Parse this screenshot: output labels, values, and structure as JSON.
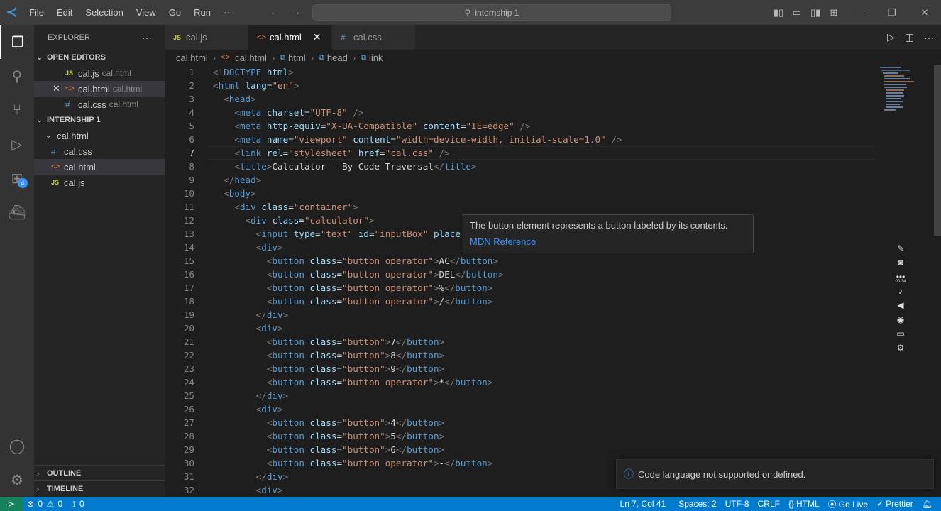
{
  "menu": [
    "File",
    "Edit",
    "Selection",
    "View",
    "Go",
    "Run",
    "···"
  ],
  "search_text": "internship 1",
  "sidebar": {
    "title": "EXPLORER",
    "open_editors_label": "OPEN EDITORS",
    "open_editors": [
      {
        "name": "cal.js",
        "desc": "cal.html",
        "type": "js"
      },
      {
        "name": "cal.html",
        "desc": "cal.html",
        "type": "html"
      },
      {
        "name": "cal.css",
        "desc": "cal.html",
        "type": "css"
      }
    ],
    "project_label": "INTERNSHIP 1",
    "folder": "cal.html",
    "files": [
      {
        "name": "cal.css",
        "type": "css"
      },
      {
        "name": "cal.html",
        "type": "html"
      },
      {
        "name": "cal.js",
        "type": "js"
      }
    ],
    "outline_label": "OUTLINE",
    "timeline_label": "TIMELINE",
    "ext_badge": "4"
  },
  "tabs": [
    {
      "label": "cal.js",
      "type": "js"
    },
    {
      "label": "cal.html",
      "type": "html"
    },
    {
      "label": "cal.css",
      "type": "css"
    }
  ],
  "breadcrumbs": [
    "cal.html",
    "cal.html",
    "html",
    "head",
    "link"
  ],
  "current_line": 7,
  "code": [
    [
      [
        "p",
        "<!"
      ],
      [
        "t",
        "DOCTYPE"
      ],
      [
        "x",
        " "
      ],
      [
        "a",
        "html"
      ],
      [
        "p",
        ">"
      ]
    ],
    [
      [
        "p",
        "<"
      ],
      [
        "t",
        "html"
      ],
      [
        "x",
        " "
      ],
      [
        "a",
        "lang"
      ],
      [
        "x",
        "="
      ],
      [
        "s",
        "\"en\""
      ],
      [
        "p",
        ">"
      ]
    ],
    [
      [
        "x",
        "  "
      ],
      [
        "p",
        "<"
      ],
      [
        "t",
        "head"
      ],
      [
        "p",
        ">"
      ]
    ],
    [
      [
        "x",
        "    "
      ],
      [
        "p",
        "<"
      ],
      [
        "t",
        "meta"
      ],
      [
        "x",
        " "
      ],
      [
        "a",
        "charset"
      ],
      [
        "x",
        "="
      ],
      [
        "s",
        "\"UTF-8\""
      ],
      [
        "x",
        " "
      ],
      [
        "p",
        "/>"
      ]
    ],
    [
      [
        "x",
        "    "
      ],
      [
        "p",
        "<"
      ],
      [
        "t",
        "meta"
      ],
      [
        "x",
        " "
      ],
      [
        "a",
        "http-equiv"
      ],
      [
        "x",
        "="
      ],
      [
        "s",
        "\"X-UA-Compatible\""
      ],
      [
        "x",
        " "
      ],
      [
        "a",
        "content"
      ],
      [
        "x",
        "="
      ],
      [
        "s",
        "\"IE=edge\""
      ],
      [
        "x",
        " "
      ],
      [
        "p",
        "/>"
      ]
    ],
    [
      [
        "x",
        "    "
      ],
      [
        "p",
        "<"
      ],
      [
        "t",
        "meta"
      ],
      [
        "x",
        " "
      ],
      [
        "a",
        "name"
      ],
      [
        "x",
        "="
      ],
      [
        "s",
        "\"viewport\""
      ],
      [
        "x",
        " "
      ],
      [
        "a",
        "content"
      ],
      [
        "x",
        "="
      ],
      [
        "s",
        "\"width=device-width, initial-scale=1.0\""
      ],
      [
        "x",
        " "
      ],
      [
        "p",
        "/>"
      ]
    ],
    [
      [
        "x",
        "    "
      ],
      [
        "p",
        "<"
      ],
      [
        "t",
        "link"
      ],
      [
        "x",
        " "
      ],
      [
        "a",
        "rel"
      ],
      [
        "x",
        "="
      ],
      [
        "s",
        "\"stylesheet\""
      ],
      [
        "x",
        " "
      ],
      [
        "a",
        "href"
      ],
      [
        "x",
        "="
      ],
      [
        "s",
        "\"cal.css\""
      ],
      [
        "x",
        " "
      ],
      [
        "p",
        "/>"
      ]
    ],
    [
      [
        "x",
        "    "
      ],
      [
        "p",
        "<"
      ],
      [
        "t",
        "title"
      ],
      [
        "p",
        ">"
      ],
      [
        "x",
        "Calculator - By Code Traversal"
      ],
      [
        "p",
        "</"
      ],
      [
        "t",
        "title"
      ],
      [
        "p",
        ">"
      ]
    ],
    [
      [
        "x",
        "  "
      ],
      [
        "p",
        "</"
      ],
      [
        "t",
        "head"
      ],
      [
        "p",
        ">"
      ]
    ],
    [
      [
        "x",
        "  "
      ],
      [
        "p",
        "<"
      ],
      [
        "t",
        "body"
      ],
      [
        "p",
        ">"
      ]
    ],
    [
      [
        "x",
        "    "
      ],
      [
        "p",
        "<"
      ],
      [
        "t",
        "div"
      ],
      [
        "x",
        " "
      ],
      [
        "a",
        "class"
      ],
      [
        "x",
        "="
      ],
      [
        "s",
        "\"container\""
      ],
      [
        "p",
        ">"
      ]
    ],
    [
      [
        "x",
        "      "
      ],
      [
        "p",
        "<"
      ],
      [
        "t",
        "div"
      ],
      [
        "x",
        " "
      ],
      [
        "a",
        "class"
      ],
      [
        "x",
        "="
      ],
      [
        "s",
        "\"calculator\""
      ],
      [
        "p",
        ">"
      ]
    ],
    [
      [
        "x",
        "        "
      ],
      [
        "p",
        "<"
      ],
      [
        "t",
        "input"
      ],
      [
        "x",
        " "
      ],
      [
        "a",
        "type"
      ],
      [
        "x",
        "="
      ],
      [
        "s",
        "\"text\""
      ],
      [
        "x",
        " "
      ],
      [
        "a",
        "id"
      ],
      [
        "x",
        "="
      ],
      [
        "s",
        "\"inputBox\""
      ],
      [
        "x",
        " "
      ],
      [
        "a",
        "place"
      ]
    ],
    [
      [
        "x",
        "        "
      ],
      [
        "p",
        "<"
      ],
      [
        "t",
        "div"
      ],
      [
        "p",
        ">"
      ]
    ],
    [
      [
        "x",
        "          "
      ],
      [
        "p",
        "<"
      ],
      [
        "t",
        "button"
      ],
      [
        "x",
        " "
      ],
      [
        "a",
        "class"
      ],
      [
        "x",
        "="
      ],
      [
        "s",
        "\"button operator\""
      ],
      [
        "p",
        ">"
      ],
      [
        "x",
        "AC"
      ],
      [
        "p",
        "</"
      ],
      [
        "t",
        "button"
      ],
      [
        "p",
        ">"
      ]
    ],
    [
      [
        "x",
        "          "
      ],
      [
        "p",
        "<"
      ],
      [
        "t",
        "button"
      ],
      [
        "x",
        " "
      ],
      [
        "a",
        "class"
      ],
      [
        "x",
        "="
      ],
      [
        "s",
        "\"button operator\""
      ],
      [
        "p",
        ">"
      ],
      [
        "x",
        "DEL"
      ],
      [
        "p",
        "</"
      ],
      [
        "t",
        "button"
      ],
      [
        "p",
        ">"
      ]
    ],
    [
      [
        "x",
        "          "
      ],
      [
        "p",
        "<"
      ],
      [
        "t",
        "button"
      ],
      [
        "x",
        " "
      ],
      [
        "a",
        "class"
      ],
      [
        "x",
        "="
      ],
      [
        "s",
        "\"button operator\""
      ],
      [
        "p",
        ">"
      ],
      [
        "x",
        "%"
      ],
      [
        "p",
        "</"
      ],
      [
        "t",
        "button"
      ],
      [
        "p",
        ">"
      ]
    ],
    [
      [
        "x",
        "          "
      ],
      [
        "p",
        "<"
      ],
      [
        "t",
        "button"
      ],
      [
        "x",
        " "
      ],
      [
        "a",
        "class"
      ],
      [
        "x",
        "="
      ],
      [
        "s",
        "\"button operator\""
      ],
      [
        "p",
        ">"
      ],
      [
        "x",
        "/"
      ],
      [
        "p",
        "</"
      ],
      [
        "t",
        "button"
      ],
      [
        "p",
        ">"
      ]
    ],
    [
      [
        "x",
        "        "
      ],
      [
        "p",
        "</"
      ],
      [
        "t",
        "div"
      ],
      [
        "p",
        ">"
      ]
    ],
    [
      [
        "x",
        "        "
      ],
      [
        "p",
        "<"
      ],
      [
        "t",
        "div"
      ],
      [
        "p",
        ">"
      ]
    ],
    [
      [
        "x",
        "          "
      ],
      [
        "p",
        "<"
      ],
      [
        "t",
        "button"
      ],
      [
        "x",
        " "
      ],
      [
        "a",
        "class"
      ],
      [
        "x",
        "="
      ],
      [
        "s",
        "\"button\""
      ],
      [
        "p",
        ">"
      ],
      [
        "x",
        "7"
      ],
      [
        "p",
        "</"
      ],
      [
        "t",
        "button"
      ],
      [
        "p",
        ">"
      ]
    ],
    [
      [
        "x",
        "          "
      ],
      [
        "p",
        "<"
      ],
      [
        "t",
        "button"
      ],
      [
        "x",
        " "
      ],
      [
        "a",
        "class"
      ],
      [
        "x",
        "="
      ],
      [
        "s",
        "\"button\""
      ],
      [
        "p",
        ">"
      ],
      [
        "x",
        "8"
      ],
      [
        "p",
        "</"
      ],
      [
        "t",
        "button"
      ],
      [
        "p",
        ">"
      ]
    ],
    [
      [
        "x",
        "          "
      ],
      [
        "p",
        "<"
      ],
      [
        "t",
        "button"
      ],
      [
        "x",
        " "
      ],
      [
        "a",
        "class"
      ],
      [
        "x",
        "="
      ],
      [
        "s",
        "\"button\""
      ],
      [
        "p",
        ">"
      ],
      [
        "x",
        "9"
      ],
      [
        "p",
        "</"
      ],
      [
        "t",
        "button"
      ],
      [
        "p",
        ">"
      ]
    ],
    [
      [
        "x",
        "          "
      ],
      [
        "p",
        "<"
      ],
      [
        "t",
        "button"
      ],
      [
        "x",
        " "
      ],
      [
        "a",
        "class"
      ],
      [
        "x",
        "="
      ],
      [
        "s",
        "\"button operator\""
      ],
      [
        "p",
        ">"
      ],
      [
        "x",
        "*"
      ],
      [
        "p",
        "</"
      ],
      [
        "t",
        "button"
      ],
      [
        "p",
        ">"
      ]
    ],
    [
      [
        "x",
        "        "
      ],
      [
        "p",
        "</"
      ],
      [
        "t",
        "div"
      ],
      [
        "p",
        ">"
      ]
    ],
    [
      [
        "x",
        "        "
      ],
      [
        "p",
        "<"
      ],
      [
        "t",
        "div"
      ],
      [
        "p",
        ">"
      ]
    ],
    [
      [
        "x",
        "          "
      ],
      [
        "p",
        "<"
      ],
      [
        "t",
        "button"
      ],
      [
        "x",
        " "
      ],
      [
        "a",
        "class"
      ],
      [
        "x",
        "="
      ],
      [
        "s",
        "\"button\""
      ],
      [
        "p",
        ">"
      ],
      [
        "x",
        "4"
      ],
      [
        "p",
        "</"
      ],
      [
        "t",
        "button"
      ],
      [
        "p",
        ">"
      ]
    ],
    [
      [
        "x",
        "          "
      ],
      [
        "p",
        "<"
      ],
      [
        "t",
        "button"
      ],
      [
        "x",
        " "
      ],
      [
        "a",
        "class"
      ],
      [
        "x",
        "="
      ],
      [
        "s",
        "\"button\""
      ],
      [
        "p",
        ">"
      ],
      [
        "x",
        "5"
      ],
      [
        "p",
        "</"
      ],
      [
        "t",
        "button"
      ],
      [
        "p",
        ">"
      ]
    ],
    [
      [
        "x",
        "          "
      ],
      [
        "p",
        "<"
      ],
      [
        "t",
        "button"
      ],
      [
        "x",
        " "
      ],
      [
        "a",
        "class"
      ],
      [
        "x",
        "="
      ],
      [
        "s",
        "\"button\""
      ],
      [
        "p",
        ">"
      ],
      [
        "x",
        "6"
      ],
      [
        "p",
        "</"
      ],
      [
        "t",
        "button"
      ],
      [
        "p",
        ">"
      ]
    ],
    [
      [
        "x",
        "          "
      ],
      [
        "p",
        "<"
      ],
      [
        "t",
        "button"
      ],
      [
        "x",
        " "
      ],
      [
        "a",
        "class"
      ],
      [
        "x",
        "="
      ],
      [
        "s",
        "\"button operator\""
      ],
      [
        "p",
        ">"
      ],
      [
        "x",
        "-"
      ],
      [
        "p",
        "</"
      ],
      [
        "t",
        "button"
      ],
      [
        "p",
        ">"
      ]
    ],
    [
      [
        "x",
        "        "
      ],
      [
        "p",
        "</"
      ],
      [
        "t",
        "div"
      ],
      [
        "p",
        ">"
      ]
    ],
    [
      [
        "x",
        "        "
      ],
      [
        "p",
        "<"
      ],
      [
        "t",
        "div"
      ],
      [
        "p",
        ">"
      ]
    ]
  ],
  "hover": {
    "text": "The button element represents a button labeled by its contents.",
    "link": "MDN Reference"
  },
  "recorder_time": "00:34",
  "toast": "Code language not supported or defined.",
  "status": {
    "errors": "0",
    "warnings": "0",
    "ports": "0",
    "position": "Ln 7, Col 41",
    "spaces": "Spaces: 2",
    "encoding": "UTF-8",
    "eol": "CRLF",
    "language": "HTML",
    "golive": "Go Live",
    "prettier": "Prettier"
  }
}
